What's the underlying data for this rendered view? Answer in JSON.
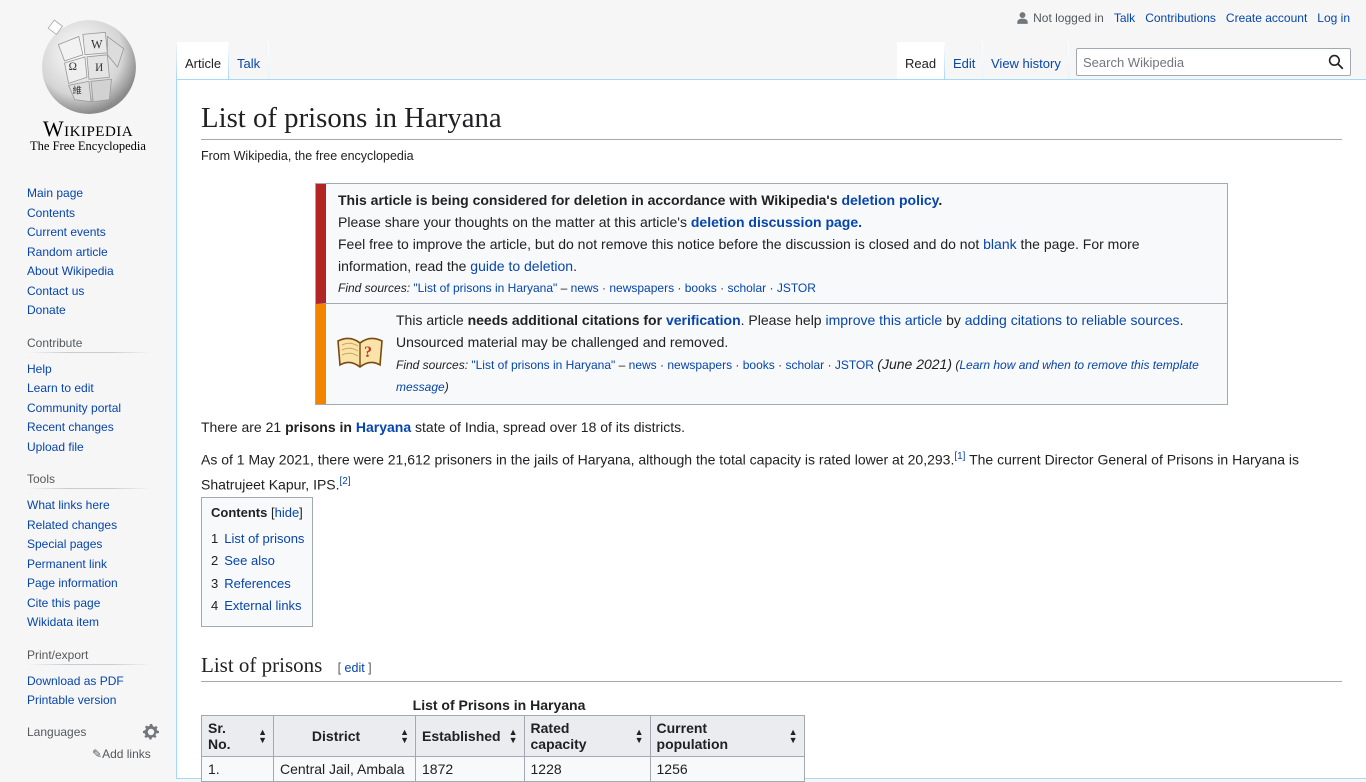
{
  "logo": {
    "wordmark": "Wikipedia",
    "tagline": "The Free Encyclopedia"
  },
  "user_links": {
    "not_logged_in": "Not logged in",
    "talk": "Talk",
    "contributions": "Contributions",
    "create_account": "Create account",
    "log_in": "Log in"
  },
  "tabs": {
    "article": "Article",
    "talk": "Talk",
    "read": "Read",
    "edit": "Edit",
    "view_history": "View history"
  },
  "search": {
    "placeholder": "Search Wikipedia"
  },
  "sidebar": {
    "navigation": [
      "Main page",
      "Contents",
      "Current events",
      "Random article",
      "About Wikipedia",
      "Contact us",
      "Donate"
    ],
    "contribute": {
      "heading": "Contribute",
      "items": [
        "Help",
        "Learn to edit",
        "Community portal",
        "Recent changes",
        "Upload file"
      ]
    },
    "tools": {
      "heading": "Tools",
      "items": [
        "What links here",
        "Related changes",
        "Special pages",
        "Permanent link",
        "Page information",
        "Cite this page",
        "Wikidata item"
      ]
    },
    "print": {
      "heading": "Print/export",
      "items": [
        "Download as PDF",
        "Printable version"
      ]
    },
    "languages": {
      "heading": "Languages",
      "add_links": "Add links"
    }
  },
  "page": {
    "title": "List of prisons in Haryana",
    "site_sub": "From Wikipedia, the free encyclopedia"
  },
  "deletion_notice": {
    "line1_bold": "This article is being considered for deletion in accordance with Wikipedia's",
    "line1_link": "deletion policy",
    "line2_text": "Please share your thoughts on the matter at this article's",
    "line2_link": "deletion discussion page.",
    "line3_a": "Feel free to improve the article, but do not remove this notice before the discussion is closed and do not",
    "line3_link": "blank",
    "line3_b": "the page. For more information, read the",
    "line3_link2": "guide to deletion",
    "find_sources_label": "Find sources:",
    "find_sources_query": "\"List of prisons in Haryana\"",
    "find_sources_items": [
      "news",
      "newspapers",
      "books",
      "scholar",
      "JSTOR"
    ]
  },
  "citation_notice": {
    "text_a": "This article",
    "text_bold": "needs additional citations for",
    "text_link": "verification",
    "text_b": ". Please help",
    "link_improve": "improve this article",
    "text_c": "by",
    "link_adding": "adding citations to reliable sources",
    "text_d": ". Unsourced material may be challenged and removed.",
    "find_sources_label": "Find sources:",
    "find_sources_query": "\"List of prisons in Haryana\"",
    "find_sources_items": [
      "news",
      "newspapers",
      "books",
      "scholar",
      "JSTOR"
    ],
    "date": "(June 2021)",
    "learn_link": "Learn how and when to remove this template message"
  },
  "intro": {
    "p1_a": "There are 21",
    "p1_bold": "prisons in",
    "p1_link": "Haryana",
    "p1_b": "state of India, spread over 18 of its districts.",
    "p2_a": "As of 1 May 2021, there were 21,612 prisoners in the jails of Haryana, although the total capacity is rated lower at 20,293.",
    "p2_ref1": "[1]",
    "p2_b": "The current Director General of Prisons in Haryana is Shatrujeet Kapur, IPS.",
    "p2_ref2": "[2]"
  },
  "toc": {
    "title": "Contents",
    "toggle": "hide",
    "items": [
      {
        "num": "1",
        "label": "List of prisons"
      },
      {
        "num": "2",
        "label": "See also"
      },
      {
        "num": "3",
        "label": "References"
      },
      {
        "num": "4",
        "label": "External links"
      }
    ]
  },
  "section": {
    "heading": "List of prisons",
    "edit": "edit"
  },
  "table": {
    "caption": "List of Prisons in Haryana",
    "headers": [
      "Sr. No.",
      "District",
      "Established",
      "Rated capacity",
      "Current population"
    ],
    "rows": [
      [
        "1.",
        "Central Jail, Ambala",
        "1872",
        "1228",
        "1256"
      ]
    ]
  }
}
